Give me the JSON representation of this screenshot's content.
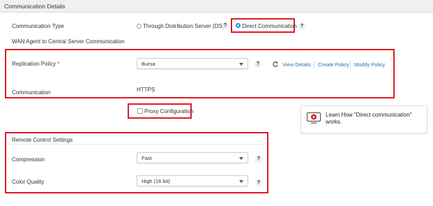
{
  "header": {
    "title": "Communication Details"
  },
  "communication_type": {
    "label": "Communication Type",
    "option_ds": "Through Distribution Server (DS)",
    "option_direct": "Direct Communication",
    "selected": "option_direct"
  },
  "help_glyph": "?",
  "wan_section": {
    "title": "WAN Agent to Central Server Communication"
  },
  "replication_policy": {
    "label": "Replication Policy",
    "required_mark": "*",
    "value": "Bursa",
    "view_details": "View Details",
    "create_policy": "Create Policy",
    "modify_policy": "Modify Policy"
  },
  "communication": {
    "label": "Communication",
    "value": "HTTPS"
  },
  "proxy": {
    "label": "Proxy Configuration",
    "checked": false
  },
  "learn_card": {
    "line1": "Learn How \"Direct communication\"",
    "line2": "works."
  },
  "remote_control": {
    "title": "Remote Control Settings",
    "compression_label": "Compression",
    "compression_value": "Fast",
    "color_quality_label": "Color Quality",
    "color_quality_value": "High (16 bit)"
  },
  "colors": {
    "annotation_red": "#e01b24",
    "link_blue": "#2a6db5",
    "radio_blue": "#1f8ce6",
    "video_icon_red": "#d9262f"
  },
  "icons": {
    "refresh": "refresh-icon",
    "help": "help-icon",
    "video": "video-icon",
    "caret": "chevron-down-icon"
  }
}
